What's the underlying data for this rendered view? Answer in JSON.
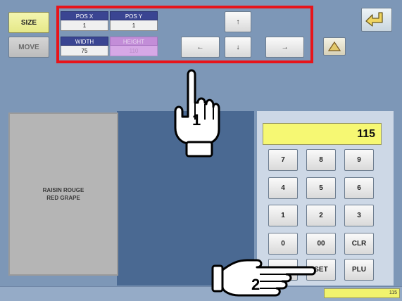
{
  "mode_buttons": {
    "size": "SIZE",
    "move": "MOVE"
  },
  "position": {
    "pos_x_label": "POS X",
    "pos_x_value": "1",
    "pos_y_label": "POS Y",
    "pos_y_value": "1",
    "width_label": "WIDTH",
    "width_value": "75",
    "height_label": "HEIGHT",
    "height_value": "110"
  },
  "arrows": {
    "up": "↑",
    "left": "←",
    "down": "↓",
    "right": "→"
  },
  "item": {
    "line1": "RAISIN ROUGE",
    "line2": "RED GRAPE"
  },
  "keypad": {
    "display": "115",
    "keys": [
      "7",
      "8",
      "9",
      "4",
      "5",
      "6",
      "1",
      "2",
      "3",
      "0",
      "00",
      "CLR",
      "",
      "SET",
      "PLU"
    ]
  },
  "status": {
    "value": "115"
  },
  "callouts": {
    "step1": "1",
    "step2": "2"
  },
  "colors": {
    "highlight": "#e8141a",
    "screen": "#7d97b7",
    "display": "#f6f873"
  }
}
